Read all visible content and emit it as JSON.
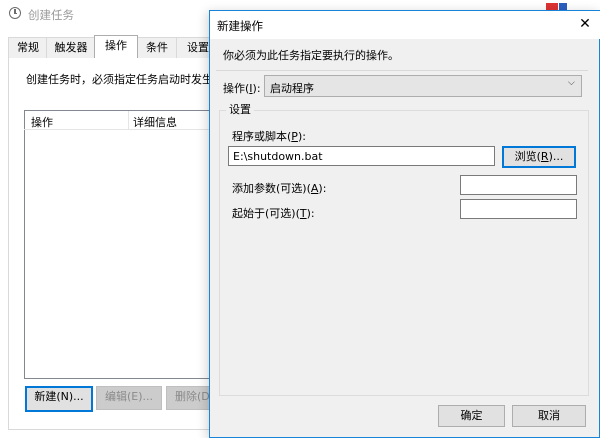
{
  "background_window": {
    "title": "创建任务",
    "tabs": [
      "常规",
      "触发器",
      "操作",
      "条件",
      "设置"
    ],
    "active_tab_index": 2,
    "description": "创建任务时，必须指定任务启动时发生的",
    "list_columns": [
      "操作",
      "详细信息"
    ],
    "buttons": {
      "new": "新建(N)...",
      "edit": "编辑(E)...",
      "delete": "删除(D"
    }
  },
  "dialog": {
    "title": "新建操作",
    "close_glyph": "✕",
    "instruction": "你必须为此任务指定要执行的操作。",
    "action_label_pre": "操作(",
    "action_label_key": "I",
    "action_label_post": "):",
    "action_value": "启动程序",
    "action_chevron": "⌵",
    "settings_group_label": "设置",
    "program_label_pre": "程序或脚本(",
    "program_label_key": "P",
    "program_label_post": "):",
    "program_value": "E:\\shutdown.bat",
    "browse_pre": "浏览(",
    "browse_key": "R",
    "browse_post": ")...",
    "args_label_pre": "添加参数(可选)(",
    "args_label_key": "A",
    "args_label_post": "):",
    "args_value": "",
    "start_in_label_pre": "起始于(可选)(",
    "start_in_label_key": "T",
    "start_in_label_post": "):",
    "start_in_value": "",
    "ok_label": "确定",
    "cancel_label": "取消"
  },
  "colors": {
    "dialog_border": "#1883d7",
    "focus_border": "#0078d7",
    "dialog_bg": "#f0f0f0"
  }
}
